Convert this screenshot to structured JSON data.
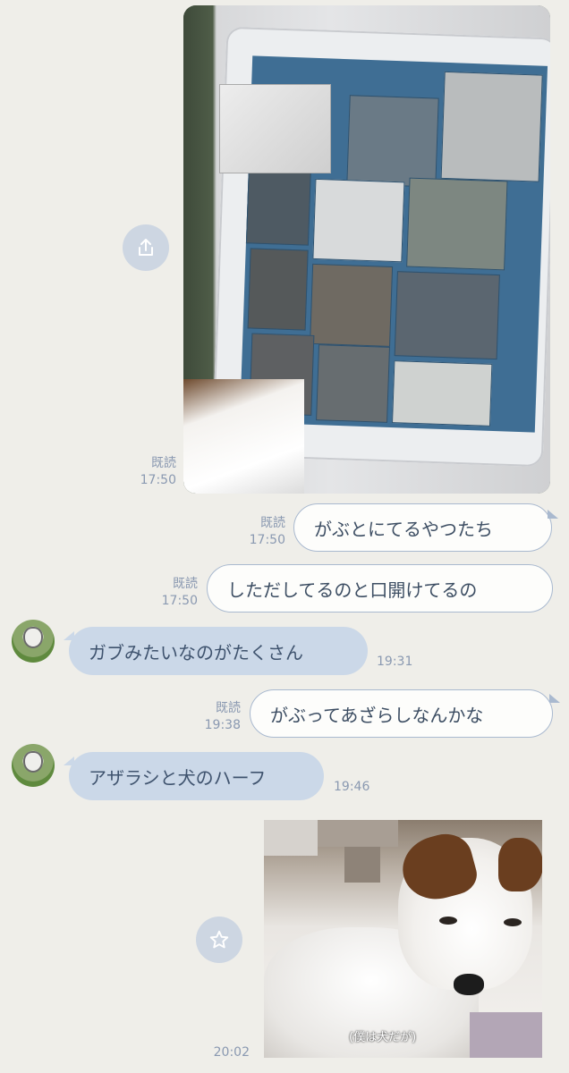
{
  "messages": [
    {
      "id": "m1",
      "type": "image",
      "direction": "outgoing",
      "content": "seal-poster-photo",
      "read": "既読",
      "time": "17:50",
      "action_icon": "share-icon"
    },
    {
      "id": "m2",
      "type": "text",
      "direction": "outgoing",
      "text": "がぶとにてるやつたち",
      "read": "既読",
      "time": "17:50"
    },
    {
      "id": "m3",
      "type": "text",
      "direction": "outgoing",
      "text": "しただしてるのと口開けてるの",
      "read": "既読",
      "time": "17:50"
    },
    {
      "id": "m4",
      "type": "text",
      "direction": "incoming",
      "text": "ガブみたいなのがたくさん",
      "time": "19:31"
    },
    {
      "id": "m5",
      "type": "text",
      "direction": "outgoing",
      "text": "がぶってあざらしなんかな",
      "read": "既読",
      "time": "19:38"
    },
    {
      "id": "m6",
      "type": "text",
      "direction": "incoming",
      "text": "アザラシと犬のハーフ",
      "time": "19:46"
    },
    {
      "id": "m7",
      "type": "image",
      "direction": "outgoing",
      "content": "dog-photo",
      "caption": "(僕は犬だが)",
      "time": "20:02",
      "action_icon": "star-icon"
    }
  ],
  "colors": {
    "background": "#efeee9",
    "outgoing_border": "#a9b9cf",
    "incoming_bubble": "#cbd8e8",
    "meta_text": "#8a99b1"
  }
}
